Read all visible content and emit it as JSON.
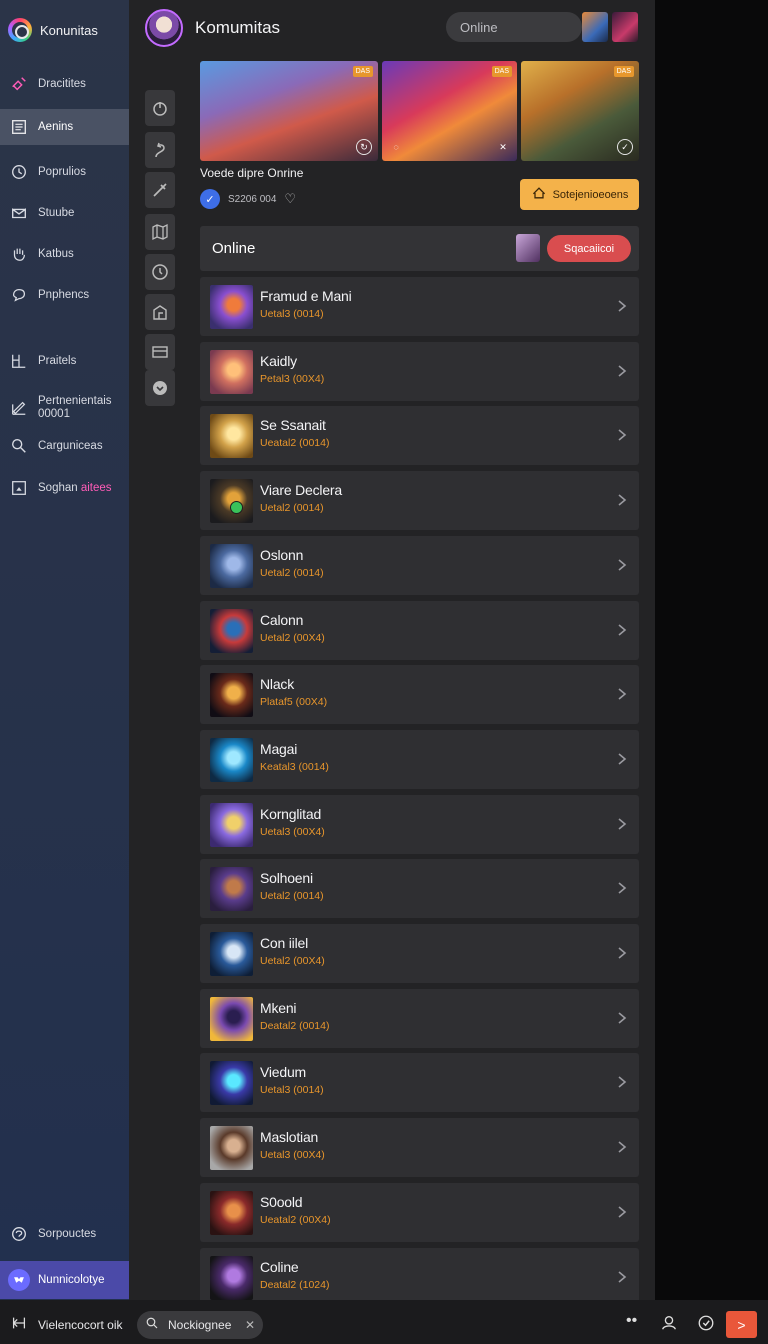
{
  "app": {
    "name": "Konunitas"
  },
  "sidebar": {
    "items": [
      {
        "label": "Dracitites",
        "icon": "joystick-icon"
      },
      {
        "label": "Aenins",
        "icon": "document-icon"
      },
      {
        "label": "Poprulios",
        "icon": "clock-icon"
      },
      {
        "label": "Stuube",
        "icon": "mail-icon"
      },
      {
        "label": "Katbus",
        "icon": "hand-icon"
      },
      {
        "label": "Pnphencs",
        "icon": "chat-icon"
      },
      {
        "label": "Praitels",
        "icon": "layout-icon"
      },
      {
        "label": "Pertnenientais",
        "label2": "00001",
        "icon": "edit-icon"
      },
      {
        "label": "Carguniceas",
        "icon": "search-icon"
      },
      {
        "label": "Soghan",
        "label_accent": "aitees",
        "icon": "image-icon"
      }
    ],
    "bottom": [
      {
        "label": "Sorpouctes",
        "icon": "support-icon"
      },
      {
        "label": "Nunnicolotye",
        "icon": "discord-icon"
      }
    ]
  },
  "header": {
    "title": "Komumitas",
    "search_value": "Online"
  },
  "featured": {
    "caption": "Voede dipre Onrine",
    "meta_count": "S2206 004",
    "action_label": "Sotejenioeoens",
    "tags": [
      "DAS",
      "DAS",
      "DAS"
    ]
  },
  "online_section": {
    "title": "Online",
    "button_label": "Sqacaiicoi"
  },
  "games": [
    {
      "name": "Framud e Mani",
      "sub": "Uetal3 (0014)",
      "colors": [
        "#3a2f6e",
        "#8a4fd0",
        "#f07b3b"
      ]
    },
    {
      "name": "Kaidly",
      "sub": "Petal3 (00X4)",
      "colors": [
        "#7a3a50",
        "#d07060",
        "#ffc07a"
      ]
    },
    {
      "name": "Se Ssanait",
      "sub": "Ueatal2 (0014)",
      "colors": [
        "#6e4a16",
        "#d2a24a",
        "#ffe7a0"
      ]
    },
    {
      "name": "Viare Declera",
      "sub": "Uetal2 (0014)",
      "colors": [
        "#1b1b1e",
        "#4b3a26",
        "#e2a23a"
      ]
    },
    {
      "name": "Oslonn",
      "sub": "Uetal2 (0014)",
      "colors": [
        "#1c2a45",
        "#4c6aa0",
        "#9fb8e8"
      ]
    },
    {
      "name": "Calonn",
      "sub": "Uetal2 (00X4)",
      "colors": [
        "#141e36",
        "#c83a3a",
        "#2a6fb8"
      ]
    },
    {
      "name": "Nlack",
      "sub": "Plataf5 (00X4)",
      "colors": [
        "#100c14",
        "#6a2a1a",
        "#f0b04a"
      ]
    },
    {
      "name": "Magai",
      "sub": "Keatal3 (0014)",
      "colors": [
        "#0e2a44",
        "#1a88c8",
        "#9fe8ff"
      ]
    },
    {
      "name": "Kornglitad",
      "sub": "Uetal3 (00X4)",
      "colors": [
        "#3c2a70",
        "#8a6ae0",
        "#f0d06a"
      ]
    },
    {
      "name": "Solhoeni",
      "sub": "Uetal2 (0014)",
      "colors": [
        "#2a1e3e",
        "#5a3c8c",
        "#c07a4a"
      ]
    },
    {
      "name": "Con iilel",
      "sub": "Uetal2 (00X4)",
      "colors": [
        "#0e1e36",
        "#2a5a9a",
        "#d8e6f6"
      ]
    },
    {
      "name": "Mkeni",
      "sub": "Deatal2 (0014)",
      "colors": [
        "#f0b83a",
        "#7a4ab0",
        "#2a1e50"
      ]
    },
    {
      "name": "Viedum",
      "sub": "Uetal3 (0014)",
      "colors": [
        "#101a34",
        "#3a3aa8",
        "#5ae8ff"
      ]
    },
    {
      "name": "Maslotian",
      "sub": "Uetal3 (00X4)",
      "colors": [
        "#a8a8a8",
        "#5a3a2a",
        "#d8b090"
      ]
    },
    {
      "name": "S0oold",
      "sub": "Ueatal2 (00X4)",
      "colors": [
        "#2a1212",
        "#8a2a2a",
        "#e8904a"
      ]
    },
    {
      "name": "Coline",
      "sub": "Deatal2 (1024)",
      "colors": [
        "#141416",
        "#4a2a6a",
        "#b07ae0"
      ]
    }
  ],
  "bottombar": {
    "left_label": "Vielencocort oik",
    "search_value": "Nockiognee"
  }
}
